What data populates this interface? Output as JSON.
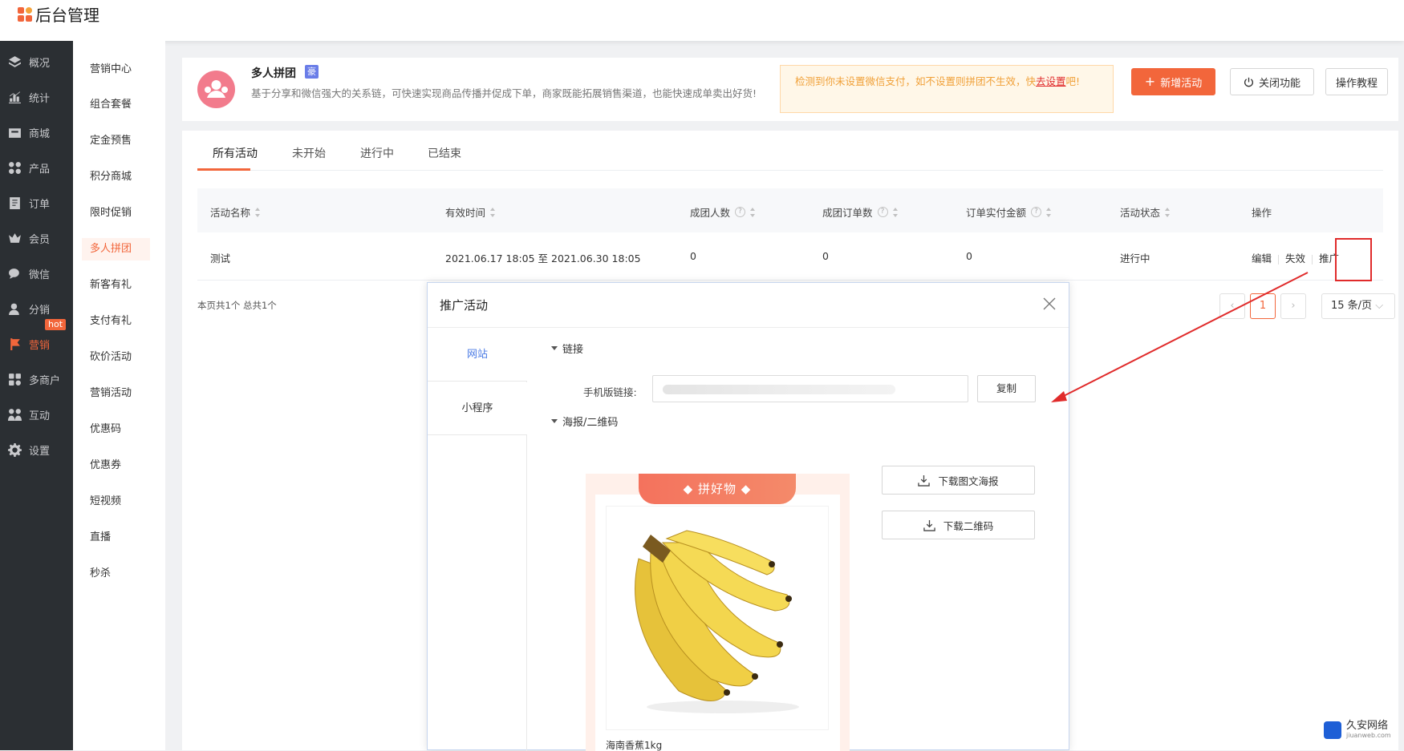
{
  "app": {
    "title": "后台管理"
  },
  "sidebar": {
    "items": [
      {
        "label": "概况",
        "icon": "layers-icon"
      },
      {
        "label": "统计",
        "icon": "chart-icon"
      },
      {
        "label": "商城",
        "icon": "store-icon"
      },
      {
        "label": "产品",
        "icon": "grid-icon"
      },
      {
        "label": "订单",
        "icon": "order-icon"
      },
      {
        "label": "会员",
        "icon": "crown-icon"
      },
      {
        "label": "微信",
        "icon": "wechat-icon"
      },
      {
        "label": "分销",
        "icon": "user-icon"
      },
      {
        "label": "营销",
        "icon": "flag-icon",
        "badge": "hot"
      },
      {
        "label": "多商户",
        "icon": "merchant-icon"
      },
      {
        "label": "互动",
        "icon": "people-icon"
      },
      {
        "label": "设置",
        "icon": "gear-icon"
      }
    ]
  },
  "submenu": {
    "items": [
      "营销中心",
      "组合套餐",
      "定金预售",
      "积分商城",
      "限时促销",
      "多人拼团",
      "新客有礼",
      "支付有礼",
      "砍价活动",
      "营销活动",
      "优惠码",
      "优惠券",
      "短视频",
      "直播",
      "秒杀"
    ],
    "active": "多人拼团"
  },
  "header": {
    "title": "多人拼团",
    "badge": "豪",
    "desc": "基于分享和微信强大的关系链，可快速实现商品传播并促成下单，商家既能拓展销售渠道，也能快速成单卖出好货!",
    "warning_text": "检测到你未设置微信支付，如不设置则拼团不生效，快",
    "warning_link": "去设置",
    "warning_tail": "吧!",
    "add_button": "新增活动",
    "close_button": "关闭功能",
    "tutorial_button": "操作教程"
  },
  "tabs": [
    "所有活动",
    "未开始",
    "进行中",
    "已结束"
  ],
  "table": {
    "columns": [
      "活动名称",
      "有效时间",
      "成团人数",
      "成团订单数",
      "订单实付金额",
      "活动状态",
      "操作"
    ],
    "rows": [
      {
        "name": "测试",
        "time": "2021.06.17 18:05 至 2021.06.30 18:05",
        "people": "0",
        "orders": "0",
        "amount": "0",
        "status": "进行中",
        "ops": [
          "编辑",
          "失效",
          "推广"
        ]
      }
    ]
  },
  "pagination": {
    "summary": "本页共1个 总共1个",
    "current": "1",
    "page_size": "15 条/页"
  },
  "modal": {
    "title": "推广活动",
    "side_tabs": [
      "网站",
      "小程序"
    ],
    "link_section": "链接",
    "mobile_link_label": "手机版链接:",
    "copy_button": "复制",
    "poster_section": "海报/二维码",
    "poster_ribbon": "拼好物",
    "product_name": "海南香蕉1kg",
    "download_poster": "下载图文海报",
    "download_qr": "下载二维码"
  },
  "watermark": {
    "name": "久安网络",
    "domain": "jiuanweb.com"
  },
  "colors": {
    "accent": "#f2663b",
    "sidebar_bg": "#2b2f33",
    "link_blue": "#4b7be5",
    "alert_red": "#e02b2b"
  }
}
